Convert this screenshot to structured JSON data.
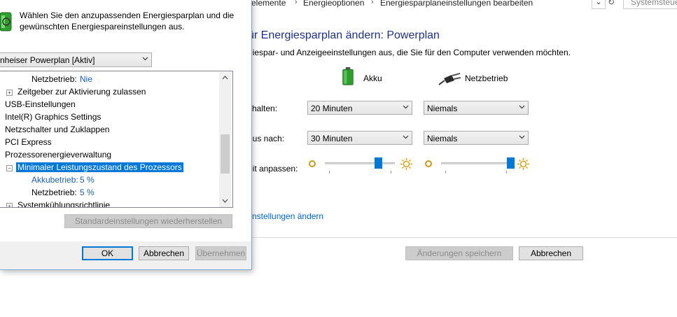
{
  "breadcrumb": {
    "items": [
      "selemente",
      "Energieoptionen",
      "Energiesparplaneinstellungen bearbeiten"
    ],
    "separator": "›",
    "dropdown_glyph": "⌄",
    "refresh_glyph": "↻",
    "search_placeholder": "Systemsteue"
  },
  "plan": {
    "title": "ür Energiesparplan ändern: Powerplan",
    "subtitle": "giespar- und Anzeigeeinstellungen aus, die Sie für den Computer verwenden möchten.",
    "columns": {
      "battery": "Akku",
      "plugged": "Netzbetrieb"
    },
    "rows": [
      {
        "label": "chalten:",
        "battery": "20 Minuten",
        "plugged": "Niemals"
      },
      {
        "label": "dus nach:",
        "battery": "30 Minuten",
        "plugged": "Niemals"
      }
    ],
    "brightness_label": "eit anpassen:",
    "brightness": {
      "battery": 0.76,
      "plugged": 0.99
    },
    "advanced_link": "nstellungen ändern",
    "save_button": "Änderungen speichern",
    "cancel_button": "Abbrechen"
  },
  "dialog": {
    "description": "Wählen Sie den anzupassenden Energiesparplan und die gewünschten Energiespareinstellungen aus.",
    "plan_select": "nheiser Powerplan [Aktiv]",
    "tree": {
      "netz_top_label": "Netzbetrieb:",
      "netz_top_value": "Nie",
      "items": [
        "Zeitgeber zur Aktivierung zulassen",
        "USB-Einstellungen",
        "Intel(R) Graphics Settings",
        "Netzschalter und Zuklappen",
        "PCI Express",
        "Prozessorenergieverwaltung",
        "Minimaler Leistungszustand des Prozessors",
        "Systemkühlungsrichtlinie"
      ],
      "akku_label": "Akkubetrieb:",
      "akku_value": "5 %",
      "netz_label": "Netzbetrieb:",
      "netz_value": "5 %"
    },
    "restore_defaults": "Standardeinstellungen wiederherstellen",
    "ok": "OK",
    "cancel": "Abbrechen",
    "apply": "Übernehmen"
  },
  "icons": {
    "battery": "battery-icon",
    "plug": "plug-icon",
    "power_options": "power-options-icon",
    "sun_dim": "sun-dim-icon",
    "sun_bright": "sun-bright-icon"
  },
  "colors": {
    "accent": "#0078d7",
    "title": "#1e3287",
    "link": "#0066cc"
  }
}
